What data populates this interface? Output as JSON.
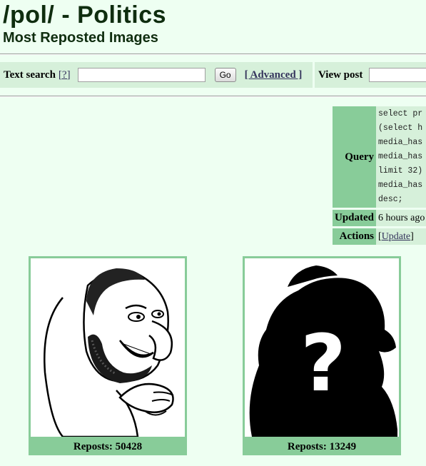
{
  "header": {
    "board_title": "/pol/ - Politics",
    "page_subtitle": "Most Reposted Images"
  },
  "search": {
    "text_search_label": "Text search",
    "help_link": "[?]",
    "go_button": "Go",
    "advanced_link": "[ Advanced ]",
    "view_post_label": "View post",
    "text_search_value": "",
    "view_post_value": ""
  },
  "info": {
    "query_label": "Query",
    "query_lines": [
      "select pr",
      "(select h",
      "media_has",
      "media_has",
      "limit 32)",
      "media_has",
      "desc;"
    ],
    "updated_label": "Updated",
    "updated_value": "6 hours ago",
    "actions_label": "Actions",
    "actions_open_bracket": "[",
    "update_link": "Update",
    "actions_close_bracket": "]"
  },
  "images": [
    {
      "reposts_text": "Reposts: 50428",
      "reposts": 50428,
      "icon": "cartoon-face-icon"
    },
    {
      "reposts_text": "Reposts: 13249",
      "reposts": 13249,
      "icon": "silhouette-question-icon"
    }
  ],
  "colors": {
    "page_bg": "#eefff2",
    "header_cell_bg": "#88cc99",
    "value_cell_bg": "#d6f0da",
    "link": "#34345c",
    "title": "#0f2d0f"
  }
}
